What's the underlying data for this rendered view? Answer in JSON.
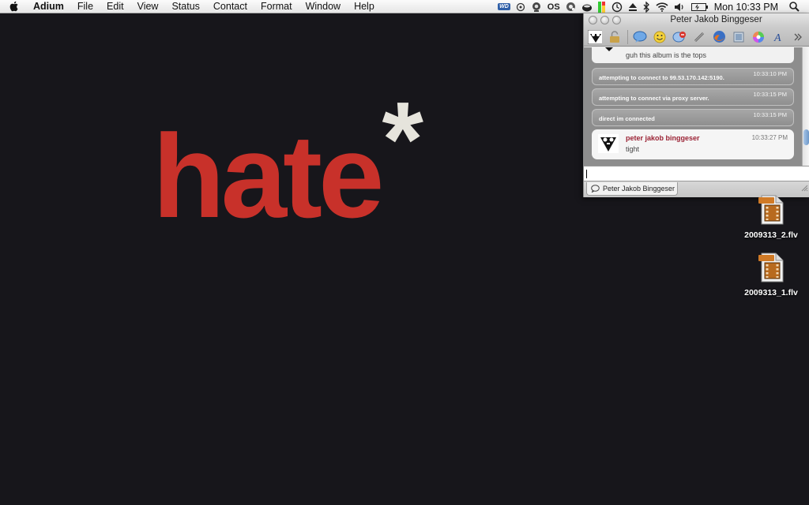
{
  "menubar": {
    "app_name": "Adium",
    "items": [
      "File",
      "Edit",
      "View",
      "Status",
      "Contact",
      "Format",
      "Window",
      "Help"
    ],
    "clock": "Mon 10:33 PM",
    "status_icons": [
      "wd-drive-icon",
      "sync-icon",
      "webcam-icon",
      "os-icon",
      "quicksilver-icon",
      "adium-duck-icon",
      "battery-meter-icon",
      "time-machine-icon",
      "eject-icon",
      "bluetooth-icon",
      "wifi-icon",
      "volume-icon",
      "battery-icon",
      "spotlight-icon"
    ],
    "os_label": "OS",
    "wd_label": "WD"
  },
  "wallpaper": {
    "word": "hate",
    "symbol": "*",
    "word_color": "#c8312a",
    "symbol_color": "#e6e4dc"
  },
  "chat_window": {
    "title": "Peter Jakob Binggeser",
    "toolbar_icons": [
      "contact-avatar-icon",
      "lock-icon",
      "message-icon",
      "smiley-icon",
      "block-icon",
      "link-icon",
      "firefox-icon",
      "send-file-icon",
      "color-wheel-icon",
      "font-icon",
      "more-icon"
    ],
    "transcript": {
      "partial_message": "guh this album is the tops",
      "status_messages": [
        {
          "text": "attempting to connect to 99.53.170.142:5190.",
          "time": "10:33:10 PM"
        },
        {
          "text": "attempting to connect via proxy server.",
          "time": "10:33:15 PM"
        },
        {
          "text": "direct im connected",
          "time": "10:33:15 PM"
        }
      ],
      "last_message": {
        "sender": "peter jakob binggeser",
        "time": "10:33:27 PM",
        "text": "tight"
      }
    },
    "input_value": "",
    "tab_label": "Peter Jakob Binggeser"
  },
  "desktop_files": [
    {
      "name": "2009313_2.flv",
      "badge": "FLV"
    },
    {
      "name": "2009313_1.flv",
      "badge": "FLV"
    }
  ]
}
